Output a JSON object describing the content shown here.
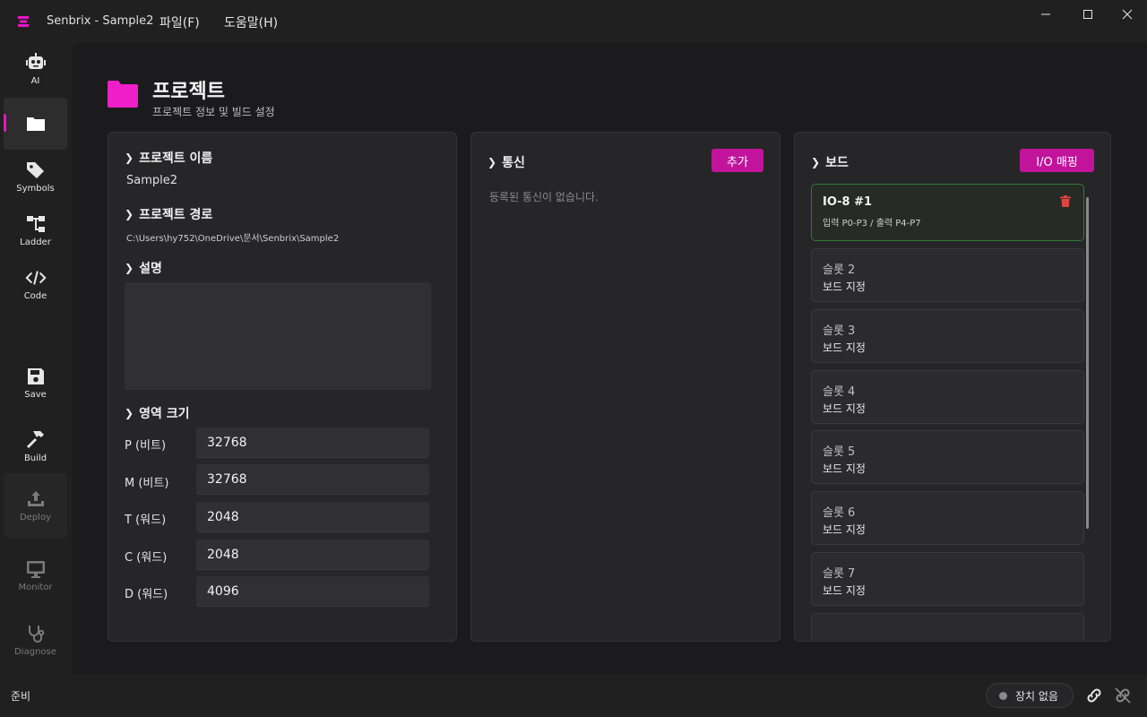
{
  "window": {
    "title": "Senbrix - Sample2",
    "menu": [
      "파일(F)",
      "도움말(H)"
    ],
    "controls": [
      "minimize",
      "maximize",
      "close"
    ]
  },
  "sidebar": {
    "items": [
      {
        "label": "AI",
        "icon": "robot-icon",
        "state": "normal"
      },
      {
        "label": "",
        "icon": "folder-icon",
        "state": "active"
      },
      {
        "label": "Symbols",
        "icon": "tag-icon",
        "state": "normal"
      },
      {
        "label": "Ladder",
        "icon": "ladder-icon",
        "state": "normal"
      },
      {
        "label": "Code",
        "icon": "code-icon",
        "state": "normal"
      },
      {
        "label": "Save",
        "icon": "save-icon",
        "state": "normal"
      },
      {
        "label": "Build",
        "icon": "hammer-icon",
        "state": "normal"
      },
      {
        "label": "Deploy",
        "icon": "upload-icon",
        "state": "disabled"
      },
      {
        "label": "Monitor",
        "icon": "monitor-icon",
        "state": "disabled"
      },
      {
        "label": "Diagnose",
        "icon": "stethoscope-icon",
        "state": "disabled"
      }
    ]
  },
  "header": {
    "title": "프로젝트",
    "subtitle": "프로젝트 정보 및 빌드 설정"
  },
  "project_panel": {
    "name_head": "프로젝트 이름",
    "name_value": "Sample2",
    "path_head": "프로젝트 경로",
    "path_value": "C:\\Users\\hy752\\OneDrive\\문서\\Senbrix\\Sample2",
    "desc_head": "설명",
    "desc_value": "",
    "area_head": "영역 크기",
    "areas": [
      {
        "label": "P (비트)",
        "value": "32768"
      },
      {
        "label": "M (비트)",
        "value": "32768"
      },
      {
        "label": "T (워드)",
        "value": "2048"
      },
      {
        "label": "C (워드)",
        "value": "2048"
      },
      {
        "label": "D (워드)",
        "value": "4096"
      }
    ]
  },
  "comm_panel": {
    "head": "통신",
    "add_label": "추가",
    "empty": "등록된 통신이 없습니다."
  },
  "board_panel": {
    "head": "보드",
    "io_label": "I/O 매핑",
    "slots": [
      {
        "title": "IO-8 #1",
        "sub": "입력 P0-P3 / 출력 P4-P7",
        "active": true
      },
      {
        "title": "슬롯 2",
        "sub": "보드 지정",
        "active": false
      },
      {
        "title": "슬롯 3",
        "sub": "보드 지정",
        "active": false
      },
      {
        "title": "슬롯 4",
        "sub": "보드 지정",
        "active": false
      },
      {
        "title": "슬롯 5",
        "sub": "보드 지정",
        "active": false
      },
      {
        "title": "슬롯 6",
        "sub": "보드 지정",
        "active": false
      },
      {
        "title": "슬롯 7",
        "sub": "보드 지정",
        "active": false
      }
    ]
  },
  "status": {
    "text": "준비",
    "device": "장치 없음"
  },
  "colors": {
    "accent": "#e614c8",
    "button": "#c1149b",
    "active_border": "#2f7a34",
    "danger": "#e0443e"
  }
}
